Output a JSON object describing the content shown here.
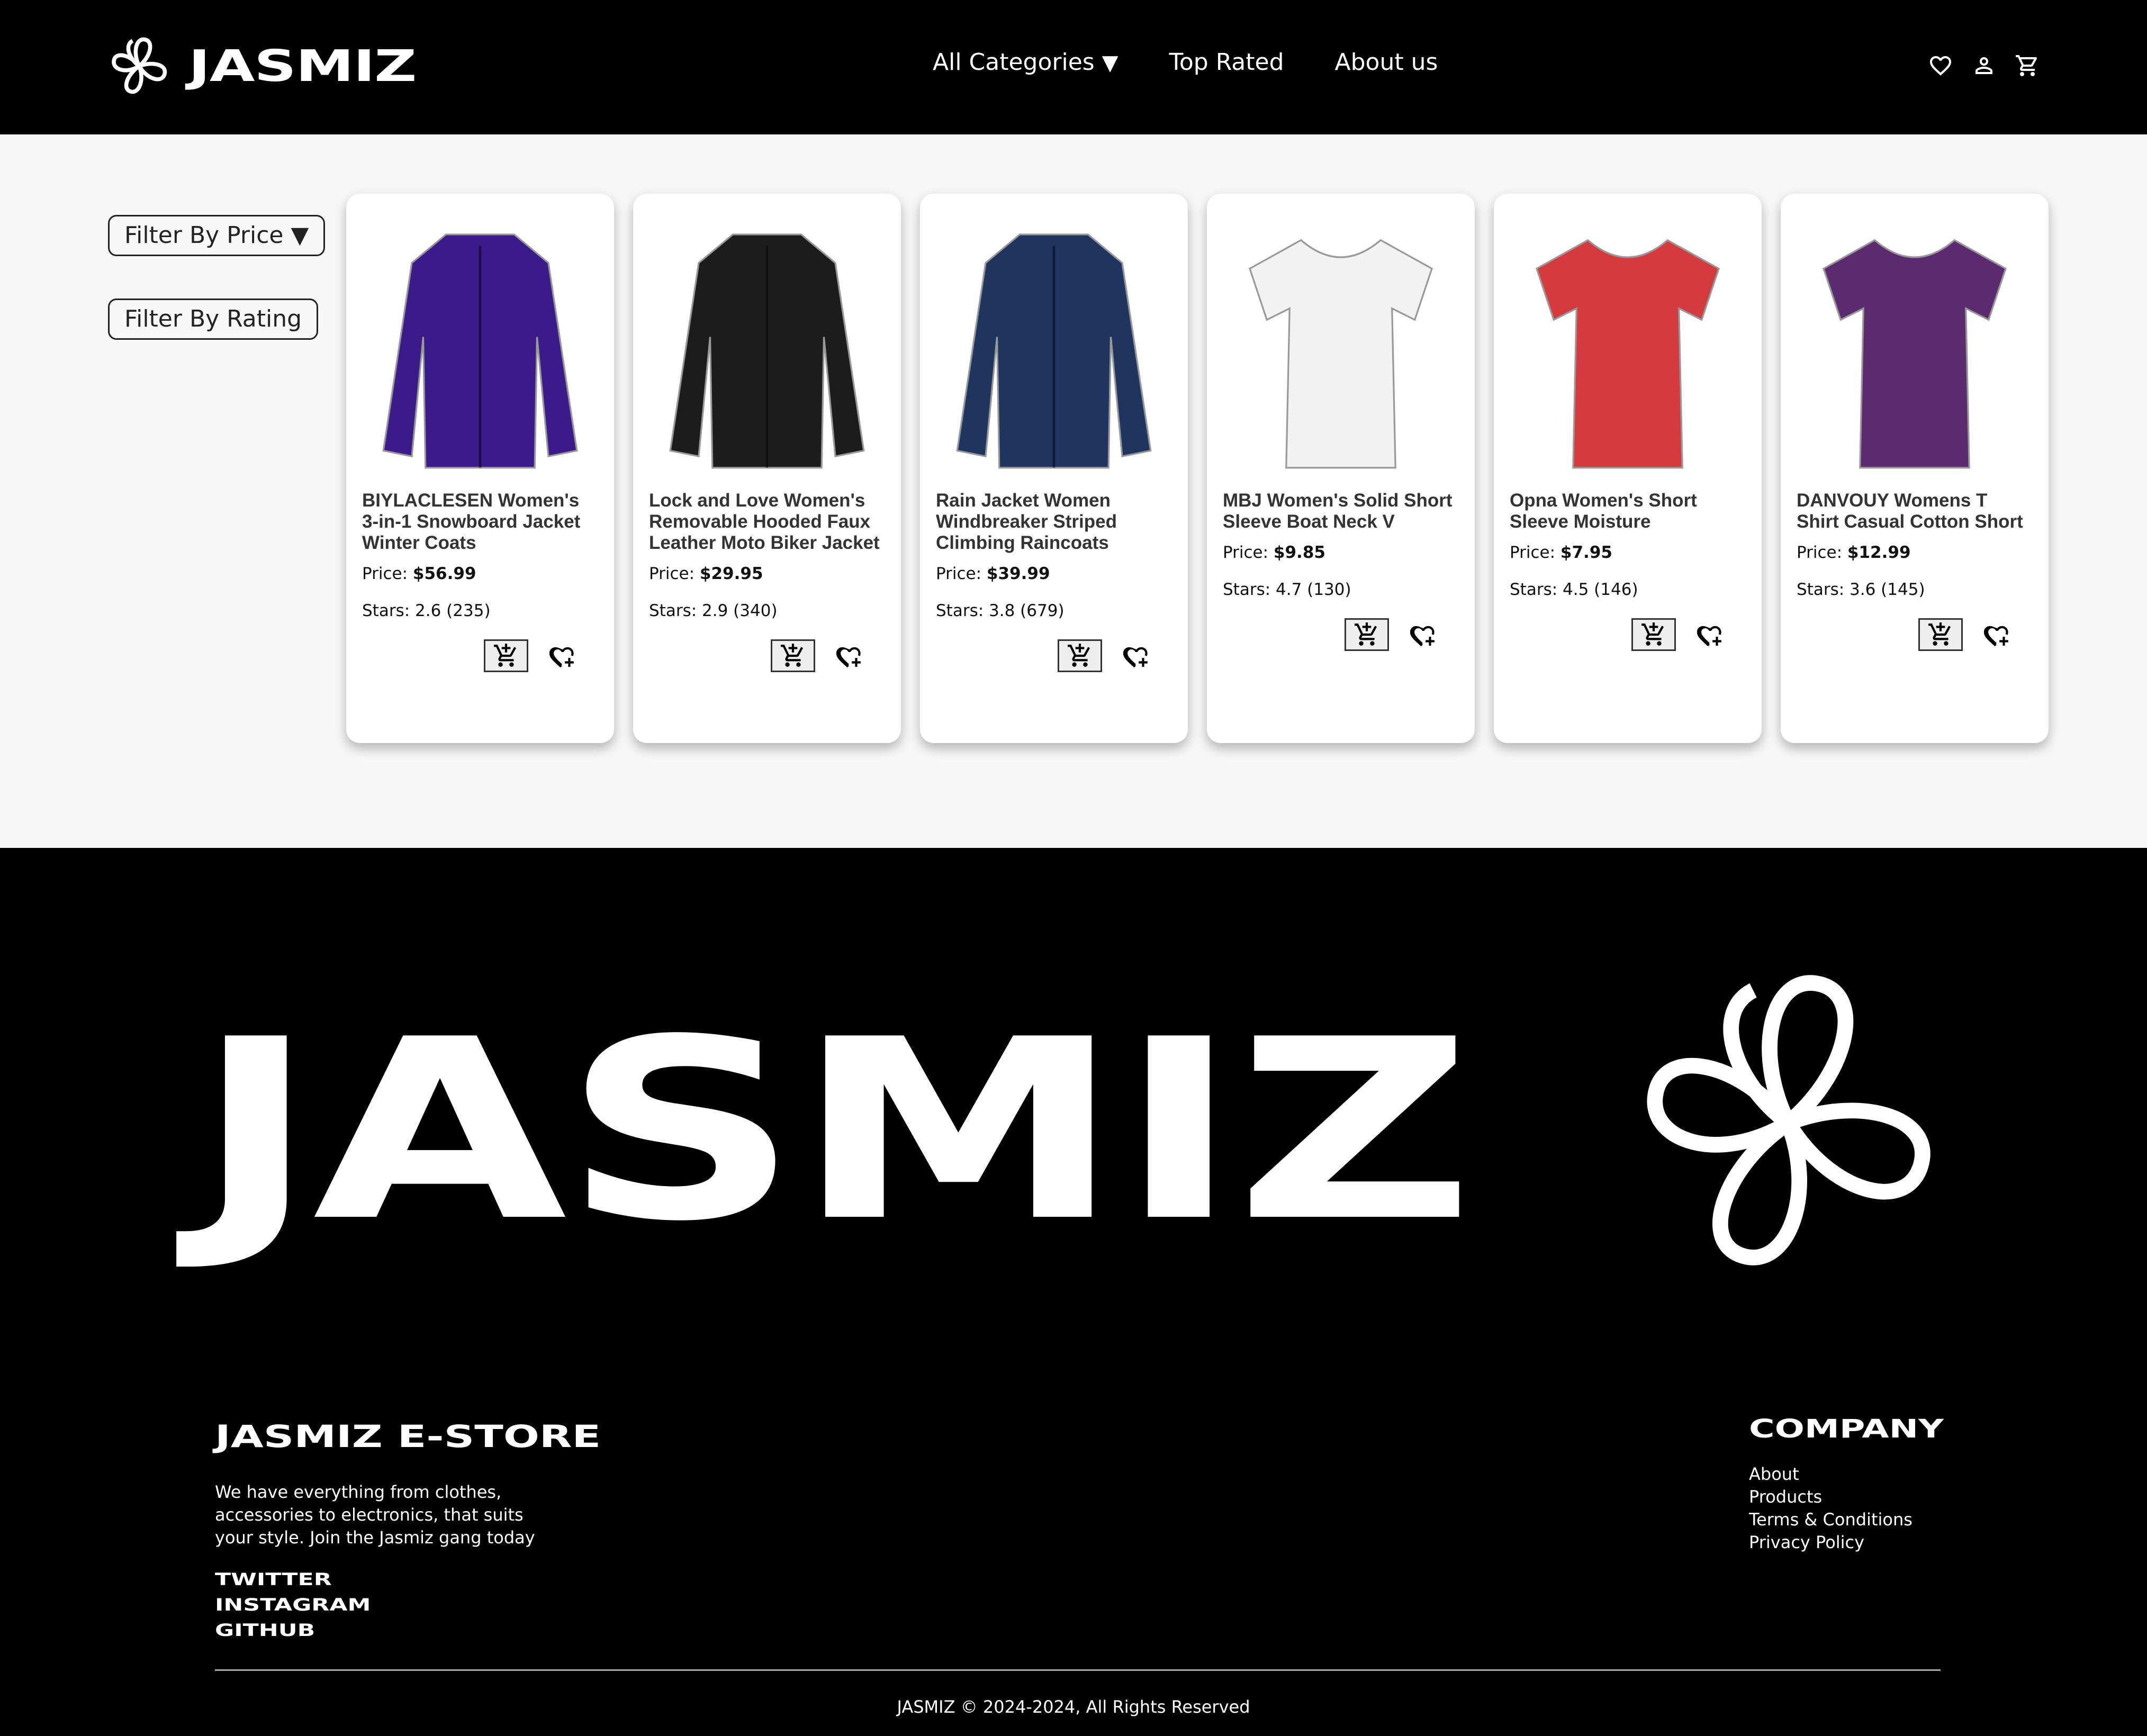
{
  "header": {
    "brand": "JASMIZ",
    "nav": [
      {
        "label": "All Categories",
        "caret": "▼"
      },
      {
        "label": "Top Rated"
      },
      {
        "label": "About us"
      }
    ],
    "icons": [
      "heart-icon",
      "user-icon",
      "cart-icon"
    ]
  },
  "filters": {
    "price_label": "Filter By Price ▼",
    "rating_label": "Filter By Rating"
  },
  "products": [
    {
      "title": "BIYLACLESEN Women's 3-in-1 Snowboard Jacket Winter Coats",
      "price_prefix": "Price: ",
      "price": "$56.99",
      "stars": "Stars: 2.6 (235)",
      "color": "#3b1a8a",
      "kind": "jacket"
    },
    {
      "title": "Lock and Love Women's Removable Hooded Faux Leather Moto Biker Jacket",
      "price_prefix": "Price: ",
      "price": "$29.95",
      "stars": "Stars: 2.9 (340)",
      "color": "#1c1c1c",
      "kind": "jacket"
    },
    {
      "title": "Rain Jacket Women Windbreaker Striped Climbing Raincoats",
      "price_prefix": "Price: ",
      "price": "$39.99",
      "stars": "Stars: 3.8 (679)",
      "color": "#1f3560",
      "kind": "jacket"
    },
    {
      "title": "MBJ Women's Solid Short Sleeve Boat Neck V",
      "price_prefix": "Price: ",
      "price": "$9.85",
      "stars": "Stars: 4.7 (130)",
      "color": "#f2f2f2",
      "kind": "shirt"
    },
    {
      "title": "Opna Women's Short Sleeve Moisture",
      "price_prefix": "Price: ",
      "price": "$7.95",
      "stars": "Stars: 4.5 (146)",
      "color": "#d53a3e",
      "kind": "shirt"
    },
    {
      "title": "DANVOUY Womens T Shirt Casual Cotton Short",
      "price_prefix": "Price: ",
      "price": "$12.99",
      "stars": "Stars: 3.6 (145)",
      "color": "#5c2a6e",
      "kind": "shirt"
    }
  ],
  "footer": {
    "brand": "JASMIZ",
    "store_title": "JASMIZ  E-STORE",
    "store_desc": "We have everything from clothes, accessories to electronics, that suits your style. Join the Jasmiz gang today",
    "social": [
      "TWITTER",
      "INSTAGRAM",
      "GITHUB"
    ],
    "company_title": "COMPANY",
    "company_links": [
      "About",
      "Products",
      "Terms & Conditions",
      "Privacy Policy"
    ],
    "copyright": "JASMIZ © 2024-2024, All Rights Reserved"
  }
}
